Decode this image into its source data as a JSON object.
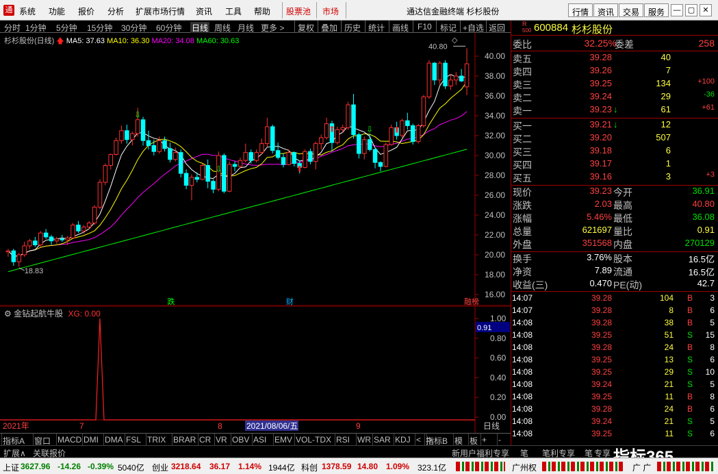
{
  "menubar": {
    "items": [
      "系统",
      "功能",
      "报价",
      "分析",
      "扩展市场行情",
      "资讯",
      "工具",
      "帮助"
    ],
    "gupiaochi": "股票池",
    "shichang": "市场",
    "app_title": "通达信金融终端 杉杉股份",
    "buttons": [
      "行情",
      "资讯",
      "交易",
      "服务"
    ]
  },
  "toolbar": {
    "items": [
      "分时",
      "1分钟",
      "5分钟",
      "15分钟",
      "30分钟",
      "60分钟",
      "日线",
      "周线",
      "月线",
      "更多 >"
    ],
    "right_items": [
      "复权",
      "叠加",
      "历史",
      "统计",
      "画线",
      "F10",
      "标记",
      "+自选",
      "返回"
    ],
    "active": "日线"
  },
  "chart_info": {
    "name": "杉杉股份(日线)",
    "ma5": "MA5: 37.63",
    "ma10": "MA10: 36.30",
    "ma20": "MA20: 34.08",
    "ma60": "MA60: 30.63",
    "colors": {
      "ma5": "#ffffff",
      "ma10": "#ffff00",
      "ma20": "#ff00ff",
      "ma60": "#00ff00",
      "up": "#ff3030",
      "down": "#00ffff"
    }
  },
  "chart_data": [
    {
      "type": "candlestick",
      "title": "杉杉股份(日线)",
      "y_ticks": [
        "40.00",
        "38.00",
        "36.00",
        "34.00",
        "32.00",
        "30.00",
        "28.00",
        "26.00",
        "24.00",
        "22.00",
        "20.00",
        "18.00",
        "16.00"
      ],
      "ylim": [
        15,
        42
      ],
      "high_label": "40.80",
      "low_label": "18.83",
      "x_labels": [
        "2021年",
        "7",
        "8",
        "2021/08/06/五",
        "9"
      ],
      "event_markers": [
        "跌",
        "财",
        "融榜"
      ],
      "candles": [
        [
          20.3,
          20.6,
          19.8,
          20.4
        ],
        [
          20.4,
          20.6,
          18.9,
          19.3
        ],
        [
          19.3,
          20.2,
          18.83,
          20.0
        ],
        [
          20.0,
          21.3,
          19.8,
          20.9
        ],
        [
          20.9,
          21.6,
          20.6,
          21.4
        ],
        [
          21.4,
          21.8,
          20.8,
          21.0
        ],
        [
          21.0,
          22.4,
          20.8,
          22.2
        ],
        [
          22.2,
          22.6,
          21.6,
          21.8
        ],
        [
          21.8,
          22.0,
          21.0,
          21.4
        ],
        [
          21.4,
          21.8,
          21.1,
          21.6
        ],
        [
          21.6,
          22.0,
          21.3,
          21.5
        ],
        [
          21.5,
          21.9,
          21.0,
          21.7
        ],
        [
          21.7,
          23.2,
          21.6,
          23.0
        ],
        [
          23.0,
          23.4,
          22.2,
          22.4
        ],
        [
          22.4,
          23.0,
          22.1,
          22.8
        ],
        [
          22.8,
          23.4,
          22.6,
          23.2
        ],
        [
          23.2,
          25.0,
          23.0,
          24.8
        ],
        [
          24.8,
          27.6,
          24.6,
          27.3
        ],
        [
          27.3,
          29.2,
          27.0,
          29.0
        ],
        [
          29.0,
          30.2,
          28.6,
          30.1
        ],
        [
          30.1,
          31.8,
          30.0,
          31.5
        ],
        [
          31.5,
          33.0,
          31.2,
          32.5
        ],
        [
          32.5,
          33.1,
          31.2,
          31.6
        ],
        [
          31.6,
          32.4,
          31.0,
          32.2
        ],
        [
          32.2,
          34.8,
          31.9,
          33.6
        ],
        [
          33.6,
          33.9,
          31.0,
          31.5
        ],
        [
          31.5,
          32.5,
          30.6,
          31.0
        ],
        [
          31.0,
          31.6,
          30.0,
          30.4
        ],
        [
          30.4,
          31.9,
          30.2,
          31.5
        ],
        [
          31.5,
          31.9,
          30.4,
          30.7
        ],
        [
          30.7,
          31.3,
          29.3,
          29.6
        ],
        [
          29.6,
          30.8,
          29.4,
          30.3
        ],
        [
          30.3,
          30.6,
          27.8,
          28.2
        ],
        [
          28.2,
          28.6,
          26.6,
          27.0
        ],
        [
          27.0,
          28.1,
          25.5,
          27.8
        ],
        [
          27.8,
          28.3,
          27.3,
          27.6
        ],
        [
          27.6,
          29.2,
          27.5,
          29.0
        ],
        [
          29.0,
          29.6,
          26.7,
          27.4
        ],
        [
          27.4,
          27.6,
          26.2,
          26.6
        ],
        [
          26.6,
          30.4,
          26.4,
          30.0
        ],
        [
          30.0,
          30.2,
          26.2,
          26.4
        ],
        [
          26.4,
          29.4,
          26.3,
          29.1
        ],
        [
          29.1,
          29.4,
          28.4,
          28.9
        ],
        [
          28.9,
          29.8,
          28.7,
          29.5
        ],
        [
          29.5,
          31.2,
          29.3,
          30.3
        ],
        [
          30.3,
          30.6,
          29.2,
          29.5
        ],
        [
          29.5,
          30.6,
          29.3,
          30.3
        ],
        [
          30.3,
          31.7,
          30.1,
          31.2
        ],
        [
          31.2,
          33.8,
          30.9,
          32.9
        ],
        [
          32.9,
          33.1,
          30.2,
          30.5
        ],
        [
          30.5,
          31.3,
          29.6,
          29.8
        ],
        [
          29.8,
          30.2,
          28.8,
          29.1
        ],
        [
          29.1,
          30.6,
          29.0,
          30.3
        ],
        [
          30.3,
          30.4,
          28.9,
          29.2
        ],
        [
          29.2,
          29.5,
          28.2,
          28.8
        ],
        [
          28.8,
          30.6,
          28.7,
          30.4
        ],
        [
          30.4,
          30.7,
          29.1,
          29.4
        ],
        [
          29.4,
          31.4,
          28.6,
          31.2
        ],
        [
          31.2,
          32.1,
          30.6,
          31.8
        ],
        [
          31.8,
          33.8,
          31.6,
          33.2
        ],
        [
          33.2,
          33.5,
          30.4,
          31.3
        ],
        [
          31.3,
          32.9,
          31.1,
          32.6
        ],
        [
          32.6,
          33.1,
          32.3,
          32.8
        ],
        [
          32.8,
          35.4,
          32.6,
          35.1
        ],
        [
          35.1,
          36.2,
          31.7,
          32.1
        ],
        [
          32.1,
          32.3,
          29.7,
          30.2
        ],
        [
          30.2,
          31.9,
          29.6,
          31.6
        ],
        [
          31.6,
          32.2,
          30.4,
          30.6
        ],
        [
          30.6,
          30.8,
          28.7,
          29.3
        ],
        [
          29.3,
          29.4,
          28.4,
          28.9
        ],
        [
          28.9,
          31.3,
          28.8,
          31.1
        ],
        [
          31.1,
          33.1,
          31.0,
          32.8
        ],
        [
          32.8,
          33.4,
          31.6,
          32.0
        ],
        [
          32.0,
          33.7,
          31.8,
          33.5
        ],
        [
          33.5,
          34.3,
          32.6,
          33.0
        ],
        [
          33.0,
          33.2,
          31.1,
          31.4
        ],
        [
          31.4,
          33.2,
          31.2,
          33.0
        ],
        [
          33.0,
          36.1,
          32.8,
          35.9
        ],
        [
          35.9,
          39.6,
          35.7,
          39.3
        ],
        [
          39.3,
          39.4,
          37.1,
          37.6
        ],
        [
          37.6,
          39.5,
          37.1,
          39.3
        ],
        [
          39.3,
          39.6,
          36.7,
          37.0
        ],
        [
          37.0,
          38.2,
          36.6,
          37.6
        ],
        [
          37.6,
          38.4,
          37.1,
          38.0
        ],
        [
          38.0,
          38.7,
          37.4,
          37.5
        ],
        [
          36.91,
          40.8,
          36.08,
          39.23
        ]
      ]
    },
    {
      "type": "line",
      "title": "金钻起航牛股",
      "xg_label": "XG: 0.00",
      "y_ticks": [
        "1.00",
        "0.91",
        "0.80",
        "0.60",
        "0.40",
        "0.20",
        "0.00"
      ],
      "ylim": [
        0,
        1
      ],
      "spike_index": 17,
      "period_label": "日线"
    }
  ],
  "quote": {
    "code": "600884",
    "name": "杉杉股份",
    "badge_r": "R",
    "badge_num": "500",
    "weibi_label": "委比",
    "weibi": "32.25%",
    "weicha_label": "委差",
    "weicha": "258",
    "asks": [
      {
        "label": "卖五",
        "price": "39.28",
        "vol": "40",
        "chg": ""
      },
      {
        "label": "卖四",
        "price": "39.26",
        "vol": "7",
        "chg": ""
      },
      {
        "label": "卖三",
        "price": "39.25",
        "vol": "134",
        "chg": "+100"
      },
      {
        "label": "卖二",
        "price": "39.24",
        "vol": "29",
        "chg": "-36"
      },
      {
        "label": "卖一",
        "price": "39.23",
        "vol": "61",
        "chg": "+61",
        "arrow": "↓"
      }
    ],
    "bids": [
      {
        "label": "买一",
        "price": "39.21",
        "vol": "12",
        "chg": "",
        "arrow": "↓"
      },
      {
        "label": "买二",
        "price": "39.20",
        "vol": "507",
        "chg": ""
      },
      {
        "label": "买三",
        "price": "39.18",
        "vol": "6",
        "chg": ""
      },
      {
        "label": "买四",
        "price": "39.17",
        "vol": "1",
        "chg": ""
      },
      {
        "label": "买五",
        "price": "39.16",
        "vol": "3",
        "chg": "+3"
      }
    ],
    "stats": [
      {
        "l1": "现价",
        "v1": "39.23",
        "l2": "今开",
        "v2": "36.91",
        "c1": "red",
        "c2": "green"
      },
      {
        "l1": "涨跌",
        "v1": "2.03",
        "l2": "最高",
        "v2": "40.80",
        "c1": "red",
        "c2": "red"
      },
      {
        "l1": "涨幅",
        "v1": "5.46%",
        "l2": "最低",
        "v2": "36.08",
        "c1": "red",
        "c2": "green"
      },
      {
        "l1": "总量",
        "v1": "621697",
        "l2": "量比",
        "v2": "0.91",
        "c1": "yel",
        "c2": "yel"
      },
      {
        "l1": "外盘",
        "v1": "351568",
        "l2": "内盘",
        "v2": "270129",
        "c1": "red",
        "c2": "green"
      }
    ],
    "stats2": [
      {
        "l1": "换手",
        "v1": "3.76%",
        "l2": "股本",
        "v2": "16.5亿"
      },
      {
        "l1": "净资",
        "v1": "7.89",
        "l2": "流通",
        "v2": "16.5亿"
      },
      {
        "l1": "收益(三)",
        "v1": "0.470",
        "l2": "PE(动)",
        "v2": "42.7"
      }
    ],
    "trades": [
      {
        "t": "14:07",
        "p": "39.28",
        "v": "104",
        "d": "B",
        "n": "3"
      },
      {
        "t": "14:07",
        "p": "39.28",
        "v": "8",
        "d": "B",
        "n": "6"
      },
      {
        "t": "14:08",
        "p": "39.28",
        "v": "38",
        "d": "B",
        "n": "5"
      },
      {
        "t": "14:08",
        "p": "39.25",
        "v": "51",
        "d": "S",
        "n": "15"
      },
      {
        "t": "14:08",
        "p": "39.28",
        "v": "24",
        "d": "B",
        "n": "8"
      },
      {
        "t": "14:08",
        "p": "39.25",
        "v": "13",
        "d": "S",
        "n": "6"
      },
      {
        "t": "14:08",
        "p": "39.25",
        "v": "29",
        "d": "S",
        "n": "10"
      },
      {
        "t": "14:08",
        "p": "39.24",
        "v": "21",
        "d": "S",
        "n": "5"
      },
      {
        "t": "14:08",
        "p": "39.25",
        "v": "11",
        "d": "B",
        "n": "8"
      },
      {
        "t": "14:08",
        "p": "39.28",
        "v": "24",
        "d": "B",
        "n": "6"
      },
      {
        "t": "14:08",
        "p": "39.24",
        "v": "21",
        "d": "S",
        "n": "5"
      },
      {
        "t": "14:08",
        "p": "39.25",
        "v": "11",
        "d": "S",
        "n": "6"
      }
    ]
  },
  "bottom_tabs": [
    "指标A",
    "窗口",
    "MACD",
    "DMI",
    "DMA",
    "FSL",
    "TRIX",
    "BRAR",
    "CR",
    "VR",
    "OBV",
    "ASI",
    "EMV",
    "VOL-TDX",
    "RSI",
    "WR",
    "SAR",
    "KDJ",
    "<",
    ">",
    "指标B",
    "模",
    "板",
    "+",
    "-"
  ],
  "bottom_tabs2": [
    "扩展∧",
    "关联报价"
  ],
  "right_bottom": {
    "tab1": "笔",
    "tab2": "笔",
    "tab3": "笔",
    "label1": "新用户福利专享",
    "label2": "笔利专享",
    "label3": "专享"
  },
  "statusbar": {
    "sh_label": "上证",
    "sh_val": "3627.96",
    "sh_chg": "-14.26",
    "sh_pct": "-0.39%",
    "sh_amt": "5040亿",
    "cy_label": "创业",
    "cy_val": "3218.64",
    "cy_chg": "36.17",
    "cy_pct": "1.14%",
    "cy_amt": "1944亿",
    "kc_label": "科创",
    "kc_val": "1378.59",
    "kc_chg": "14.80",
    "kc_pct": "1.09%",
    "kc_amt": "323.1亿",
    "right1": "广州权",
    "right2": "广 广",
    "watermark": "指标365"
  }
}
